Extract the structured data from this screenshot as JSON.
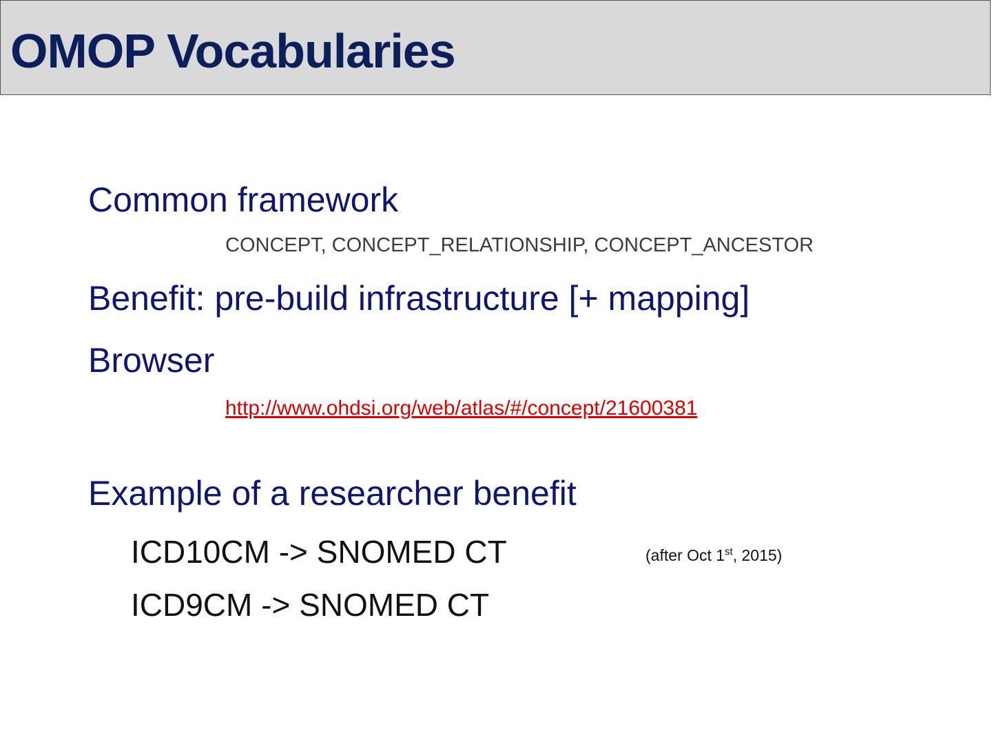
{
  "slide": {
    "title": "OMOP Vocabularies"
  },
  "sections": {
    "common_framework": "Common framework",
    "tables": "CONCEPT, CONCEPT_RELATIONSHIP, CONCEPT_ANCESTOR",
    "benefit": "Benefit: pre-build infrastructure [+ mapping]",
    "browser": "Browser",
    "browser_link": "http://www.ohdsi.org/web/atlas/#/concept/21600381",
    "example_heading": "Example of a researcher benefit"
  },
  "examples": {
    "icd10": "ICD10CM -> SNOMED CT",
    "icd10_note_prefix": "(after Oct 1",
    "icd10_note_sup": "st",
    "icd10_note_suffix": ", 2015)",
    "icd9": "ICD9CM -> SNOMED CT"
  },
  "colors": {
    "title_bar_bg": "#d9d9d9",
    "title_text": "#0b1f5c",
    "heading_text": "#0d1773",
    "link": "#e00000"
  }
}
